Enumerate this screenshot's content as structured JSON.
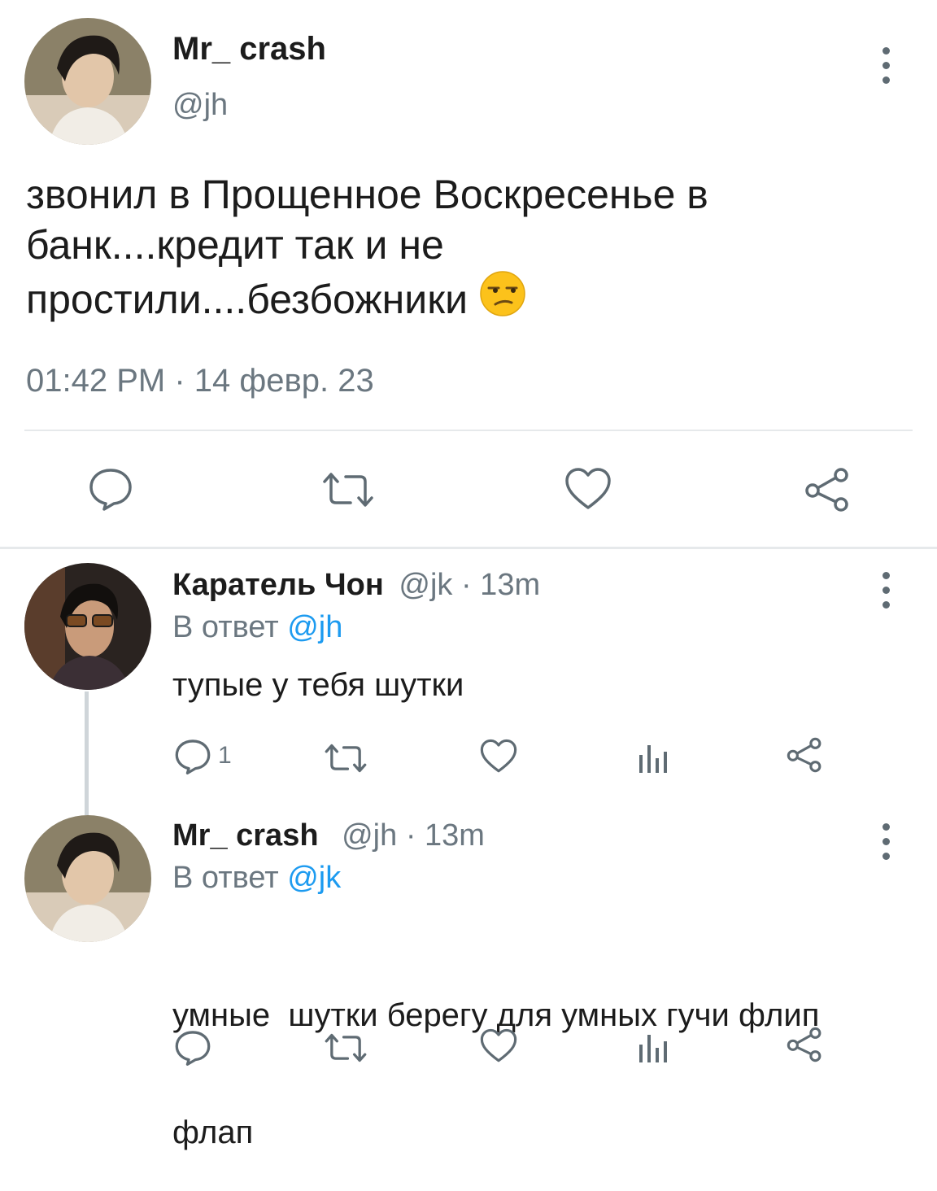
{
  "main_tweet": {
    "display_name": "Mr_ crash",
    "handle": "@jh",
    "text_line1": "звонил в Прощенное Воскресенье в",
    "text_line2": "банк....кредит так и не",
    "text_line3": "простили....безбожники",
    "emoji": "unamused-face-emoji",
    "timestamp": "01:42 PM · 14 февр. 23",
    "actions": [
      "reply-icon",
      "retweet-icon",
      "like-icon",
      "share-icon"
    ]
  },
  "replies": [
    {
      "display_name": "Каратель Чон",
      "handle": "@jk",
      "time": "· 13m",
      "reply_prefix": "В ответ",
      "reply_to": "@jh",
      "text": "тупые у тебя шутки",
      "reply_count": "1",
      "actions": [
        "reply-icon",
        "retweet-icon",
        "like-icon",
        "views-icon",
        "share-icon"
      ]
    },
    {
      "display_name": "Mr_ crash",
      "handle": "@jh",
      "time": "· 13m",
      "reply_prefix": "В ответ",
      "reply_to": "@jk",
      "text_line1": "умные  шутки берегу для умных гучи флип",
      "text_line2": "флап",
      "actions": [
        "reply-icon",
        "retweet-icon",
        "like-icon",
        "views-icon",
        "share-icon"
      ]
    }
  ],
  "colors": {
    "text": "#1c1c1c",
    "secondary": "#6b7780",
    "link": "#1d9bf0",
    "icon": "#5f6b73",
    "divider": "#e6e9eb"
  }
}
